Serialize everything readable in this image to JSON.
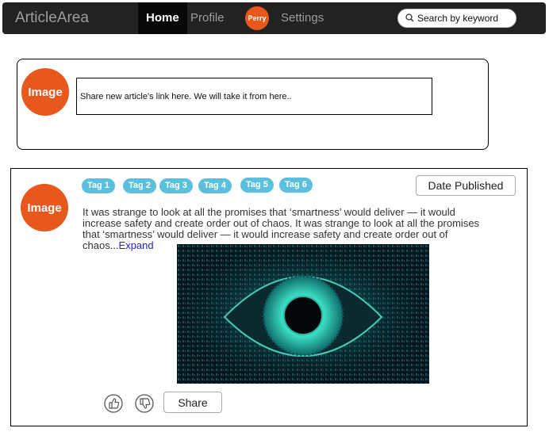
{
  "navbar": {
    "brand": "ArticleArea",
    "links": [
      {
        "label": "Home",
        "active": true
      },
      {
        "label": "Profile",
        "active": false
      }
    ],
    "user_avatar_label": "Perry",
    "settings_label": "Settings",
    "search": {
      "placeholder": "Search by keyword",
      "value": ""
    }
  },
  "share": {
    "avatar_label": "Image",
    "input_placeholder": "Share new article's link here. We will take it from here.."
  },
  "article": {
    "avatar_label": "Image",
    "tags": [
      "Tag 1",
      "Tag 2",
      "Tag 3",
      "Tag 4",
      "Tag 5",
      "Tag 6"
    ],
    "date_button_label": "Date Published",
    "text": "It was strange to look at all the promises that ‘smartness’ would deliver — it would increase safety and create order out of chaos. It was strange to look at all the promises that ‘smartness’ would deliver — it would increase safety and create order out of chaos...",
    "expand_label": "Expand",
    "image_icon": "digital-eye-icon",
    "like_icon": "thumbs-up-icon",
    "dislike_icon": "thumbs-down-icon",
    "share_label": "Share"
  },
  "colors": {
    "navbar_bg": "#222222",
    "avatar_orange": "#e8581c",
    "tag_blue": "#5bc0de",
    "link_blue": "#2222cc"
  }
}
